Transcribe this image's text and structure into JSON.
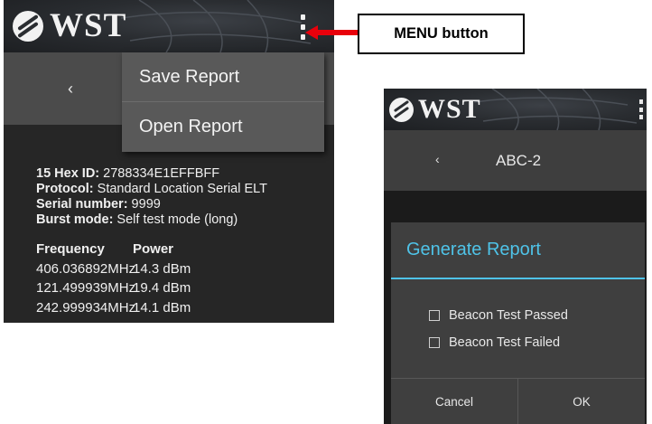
{
  "left_screen": {
    "logo_text": "WST",
    "back_glyph": "‹",
    "menu": {
      "items": [
        {
          "label": "Save Report"
        },
        {
          "label": "Open Report"
        }
      ]
    },
    "info": {
      "hex_id_label": "15 Hex ID:",
      "hex_id_value": " 2788334E1EFFBFF",
      "protocol_label": "Protocol:",
      "protocol_value": " Standard Location Serial ELT",
      "serial_label": "Serial number:",
      "serial_value": " 9999",
      "burst_label": "Burst mode:",
      "burst_value": " Self test mode (long)"
    },
    "table": {
      "headers": [
        "Frequency",
        "Power"
      ],
      "rows": [
        [
          "406.036892MHz",
          "14.3 dBm"
        ],
        [
          "121.499939MHz",
          "19.4 dBm"
        ],
        [
          "242.999934MHz",
          "14.1 dBm"
        ]
      ]
    }
  },
  "callout": {
    "label": "MENU button",
    "arrow_color": "#e8000b"
  },
  "right_screen": {
    "logo_text": "WST",
    "back_glyph": "‹",
    "title": "ABC-2",
    "dialog": {
      "title": "Generate Report",
      "options": [
        {
          "label": "Beacon Test Passed",
          "checked": false
        },
        {
          "label": "Beacon Test Failed",
          "checked": false
        }
      ],
      "cancel_label": "Cancel",
      "ok_label": "OK"
    }
  },
  "colors": {
    "accent": "#4fc3e8",
    "dark_bg": "#262626",
    "menu_bg": "#595959"
  }
}
